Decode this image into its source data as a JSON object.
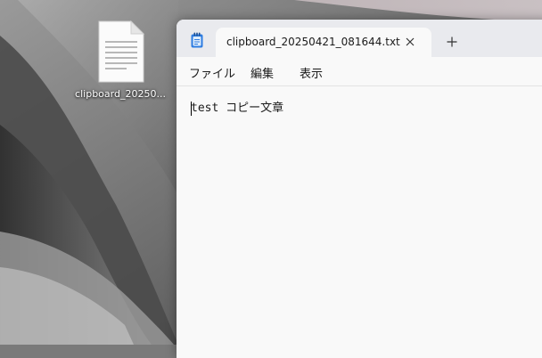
{
  "desktop": {
    "icons": [
      {
        "label": "clipboard_20250..."
      }
    ]
  },
  "notepad": {
    "tab": {
      "title": "clipboard_20250421_081644.txt"
    },
    "menu": [
      "ファイル",
      "編集",
      "表示"
    ],
    "editor": {
      "text": "test コピー文章"
    },
    "accent": "#1f6fd6"
  }
}
